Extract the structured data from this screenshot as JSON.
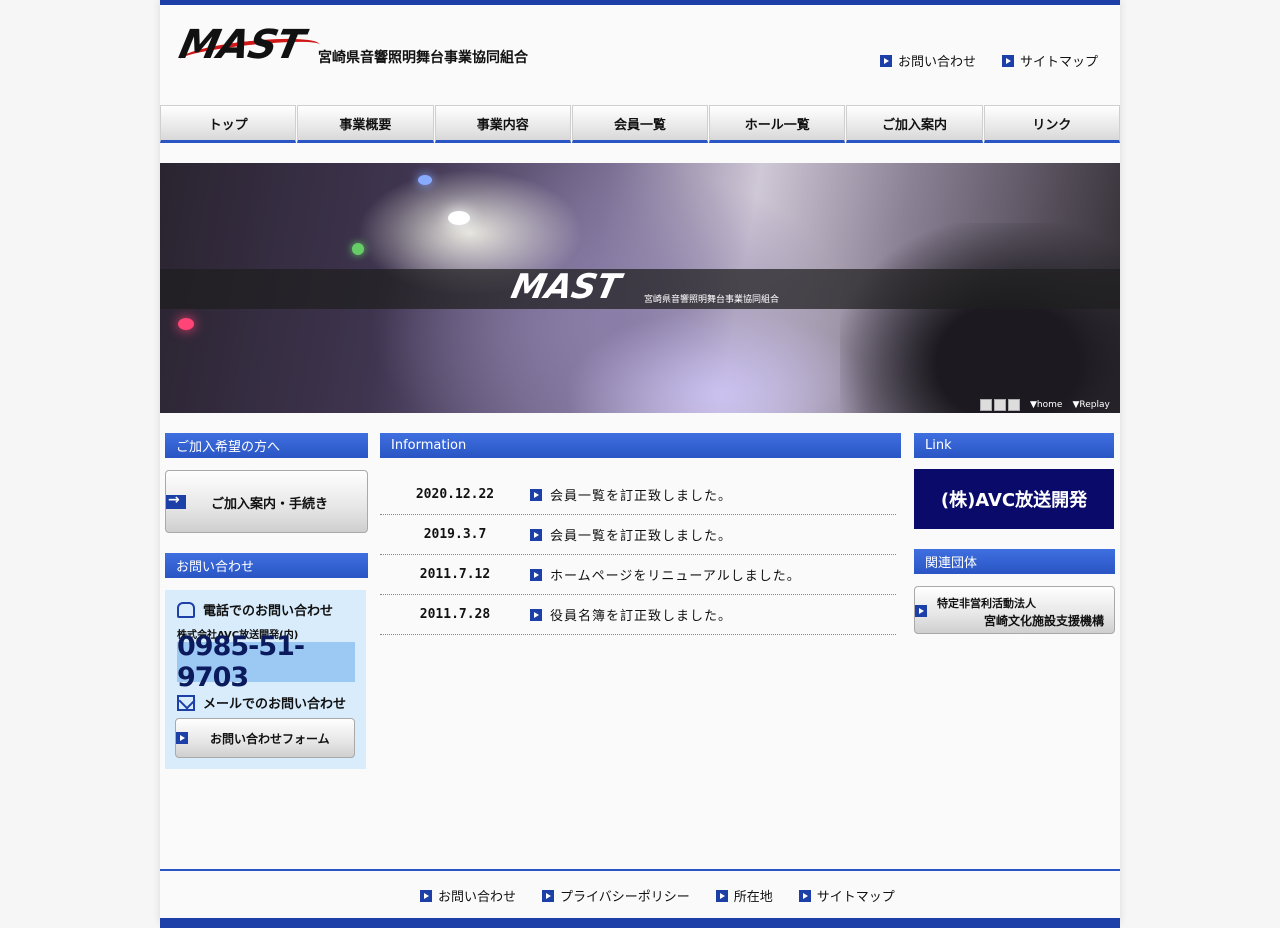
{
  "header": {
    "logo_text": "MAST",
    "logo_subtitle": "宮崎県音響照明舞台事業協同組合",
    "top_links": [
      {
        "label": "お問い合わせ"
      },
      {
        "label": "サイトマップ"
      }
    ]
  },
  "nav": {
    "items": [
      {
        "label": "トップ"
      },
      {
        "label": "事業概要"
      },
      {
        "label": "事業内容"
      },
      {
        "label": "会員一覧"
      },
      {
        "label": "ホール一覧"
      },
      {
        "label": "ご加入案内"
      },
      {
        "label": "リンク"
      }
    ]
  },
  "hero": {
    "logo_text": "MAST",
    "logo_subtitle": "宮崎県音響照明舞台事業協同組合",
    "controls": {
      "home_label": "▼home",
      "replay_label": "▼Replay"
    }
  },
  "left": {
    "join_heading": "ご加入希望の方へ",
    "join_button": "ご加入案内・手続き",
    "contact_heading": "お問い合わせ",
    "phone_title": "電話でのお問い合わせ",
    "company": "株式会社AVC放送開発(内)",
    "phone_number": "0985-51-9703",
    "mail_title": "メールでのお問い合わせ",
    "form_button": "お問い合わせフォーム"
  },
  "info": {
    "heading": "Information",
    "rows": [
      {
        "date": "2020.12.22",
        "text": "会員一覧を訂正致しました。"
      },
      {
        "date": "2019.3.7",
        "text": "会員一覧を訂正致しました。"
      },
      {
        "date": "2011.7.12",
        "text": "ホームページをリニューアルしました。"
      },
      {
        "date": "2011.7.28",
        "text": "役員名簿を訂正致しました。"
      }
    ]
  },
  "right": {
    "link_heading": "Link",
    "avc_banner": "(株)AVC放送開発",
    "related_heading": "関連団体",
    "npo_line1": "特定非営利活動法人",
    "npo_line2": "宮崎文化施設支援機構"
  },
  "footer": {
    "links": [
      {
        "label": "お問い合わせ"
      },
      {
        "label": "プライバシーポリシー"
      },
      {
        "label": "所在地"
      },
      {
        "label": "サイトマップ"
      }
    ]
  },
  "colors": {
    "brand_blue": "#1d3fa8",
    "heading_blue": "#2a55c4",
    "logo_red": "#d01818",
    "banner_navy": "#0a0a6a",
    "contact_bg": "#d8ecfb"
  }
}
